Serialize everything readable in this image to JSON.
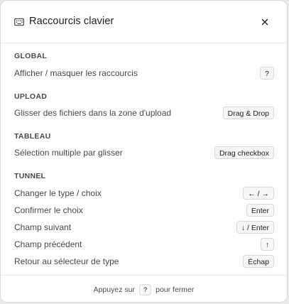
{
  "dialog": {
    "title": "Raccourcis clavier",
    "title_icon": "keyboard-icon",
    "close_icon": "close-icon"
  },
  "sections": [
    {
      "title": "GLOBAL",
      "rows": [
        {
          "label": "Afficher / masquer les raccourcis",
          "key": "?"
        }
      ]
    },
    {
      "title": "UPLOAD",
      "rows": [
        {
          "label": "Glisser des fichiers dans la zone d'upload",
          "key": "Drag & Drop"
        }
      ]
    },
    {
      "title": "TABLEAU",
      "rows": [
        {
          "label": "Sélection multiple par glisser",
          "key": "Drag checkbox"
        }
      ]
    },
    {
      "title": "TUNNEL",
      "rows": [
        {
          "label": "Changer le type / choix",
          "key": "← / →"
        },
        {
          "label": "Confirmer le choix",
          "key": "Enter"
        },
        {
          "label": "Champ suivant",
          "key": "↓ / Enter"
        },
        {
          "label": "Champ précédent",
          "key": "↑"
        },
        {
          "label": "Retour au sélecteur de type",
          "key": "Échap"
        }
      ]
    }
  ],
  "footer": {
    "prefix": "Appuyez sur",
    "key": "?",
    "suffix": "pour fermer"
  }
}
